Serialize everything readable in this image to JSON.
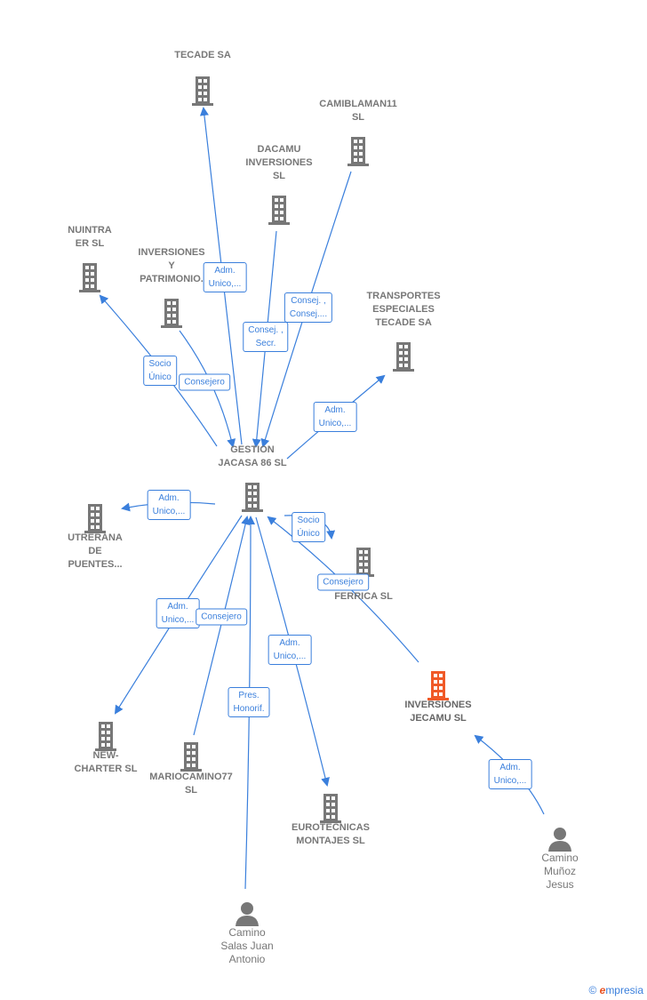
{
  "colors": {
    "edge": "#3a7fdc",
    "company": "#777777",
    "highlight": "#f05a28",
    "person": "#777777"
  },
  "nodes": [
    {
      "id": "tecade",
      "label": "TECADE SA",
      "type": "company"
    },
    {
      "id": "camiblaman",
      "label": "CAMIBLAMAN11\nSL",
      "type": "company"
    },
    {
      "id": "dacamu",
      "label": "DACAMU\nINVERSIONES\nSL",
      "type": "company"
    },
    {
      "id": "nuintra",
      "label": "NUINTRA\nER SL",
      "type": "company"
    },
    {
      "id": "invpat",
      "label": "INVERSIONES\nY\nPATRIMONIO.",
      "type": "company"
    },
    {
      "id": "transportes",
      "label": "TRANSPORTES\nESPECIALES\nTECADE SA",
      "type": "company"
    },
    {
      "id": "gestion",
      "label": "GESTION\nJACASA 86  SL",
      "type": "company"
    },
    {
      "id": "utrerana",
      "label": "UTRERANA\nDE\nPUENTES...",
      "type": "company"
    },
    {
      "id": "ferrica",
      "label": "FERRICA  SL",
      "type": "company"
    },
    {
      "id": "jecamu",
      "label": "INVERSIONES\nJECAMU  SL",
      "type": "company-highlight"
    },
    {
      "id": "newcharter",
      "label": "NEW-\nCHARTER  SL",
      "type": "company"
    },
    {
      "id": "mariocamino",
      "label": "MARIOCAMINO77\nSL",
      "type": "company"
    },
    {
      "id": "eurotecnicas",
      "label": "EUROTECNICAS\nMONTAJES SL",
      "type": "company"
    },
    {
      "id": "caminomunoz",
      "label": "Camino\nMuñoz\nJesus",
      "type": "person"
    },
    {
      "id": "caminosalas",
      "label": "Camino\nSalas Juan\nAntonio",
      "type": "person"
    }
  ],
  "edges": [
    {
      "label": "Adm.\nUnico,..."
    },
    {
      "label": "Consej. ,\nConsej...."
    },
    {
      "label": "Consej. ,\nSecr."
    },
    {
      "label": "Socio\nÚnico"
    },
    {
      "label": "Consejero"
    },
    {
      "label": "Adm.\nUnico,..."
    },
    {
      "label": "Adm.\nUnico,..."
    },
    {
      "label": "Socio\nÚnico"
    },
    {
      "label": "Consejero"
    },
    {
      "label": "Adm.\nUnico,..."
    },
    {
      "label": "Consejero"
    },
    {
      "label": "Pres.\nHonorif."
    },
    {
      "label": "Adm.\nUnico,..."
    },
    {
      "label": "Adm.\nUnico,..."
    }
  ],
  "footer": {
    "copyright": "©",
    "brand_first": "e",
    "brand_rest": "mpresia"
  }
}
